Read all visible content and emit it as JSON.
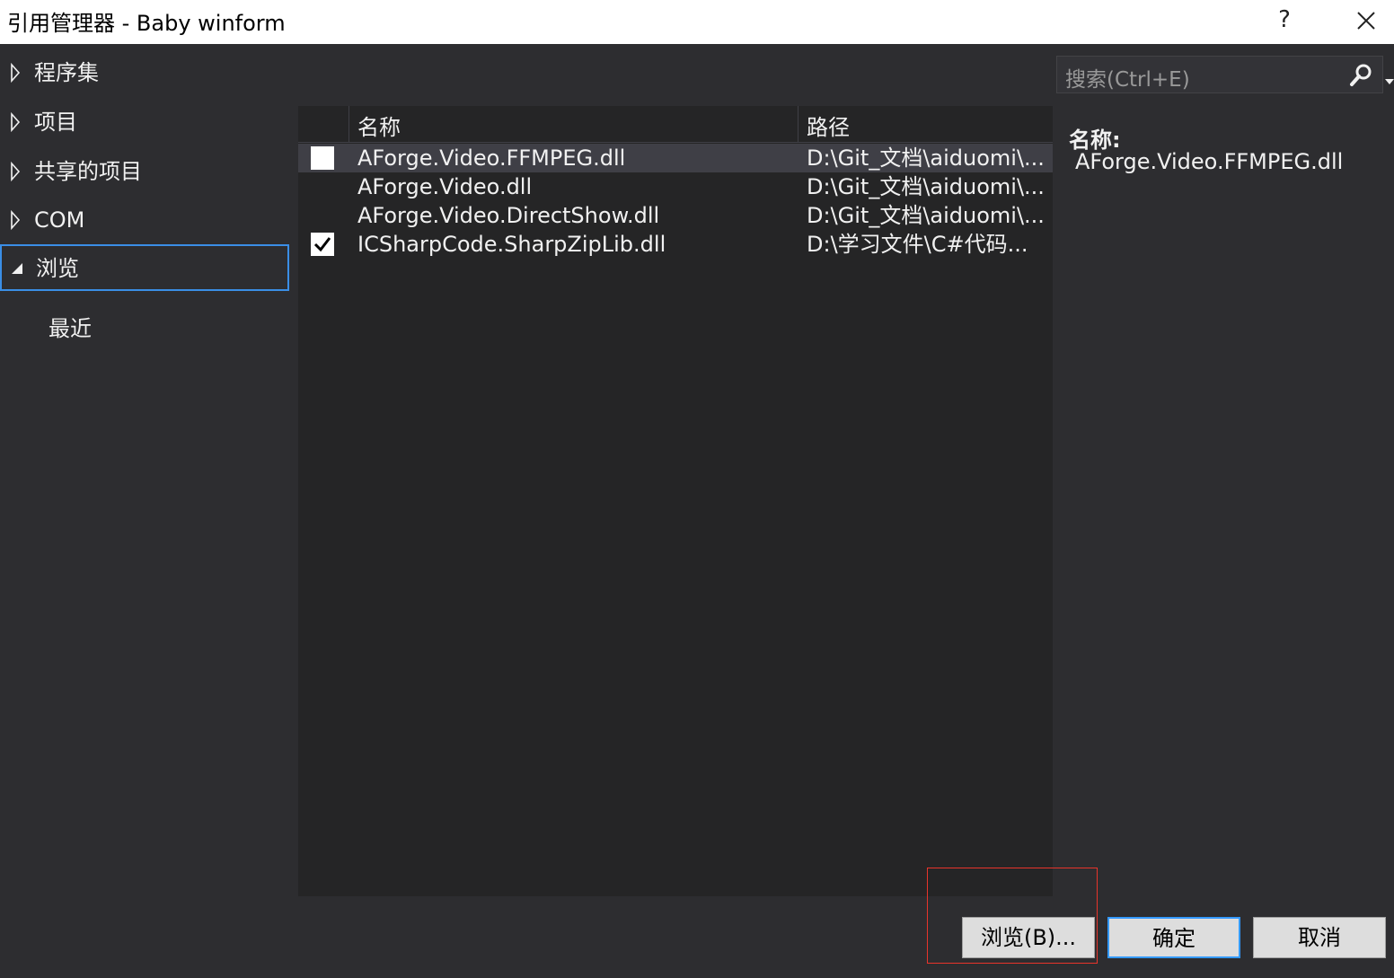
{
  "window": {
    "title": "引用管理器 - Baby winform",
    "help_label": "?"
  },
  "sidebar": {
    "items": [
      {
        "label": "程序集",
        "expanded": false
      },
      {
        "label": "项目",
        "expanded": false
      },
      {
        "label": "共享的项目",
        "expanded": false
      },
      {
        "label": "COM",
        "expanded": false
      },
      {
        "label": "浏览",
        "expanded": true,
        "selected": true
      }
    ],
    "sub_items": [
      {
        "label": "最近"
      }
    ]
  },
  "list": {
    "columns": [
      "名称",
      "路径"
    ],
    "rows": [
      {
        "name": "AForge.Video.FFMPEG.dll",
        "path": "D:\\Git_文档\\aiduomi\\...",
        "checked": false,
        "selected": true
      },
      {
        "name": "AForge.Video.dll",
        "path": "D:\\Git_文档\\aiduomi\\...",
        "checked": false,
        "selected": false
      },
      {
        "name": "AForge.Video.DirectShow.dll",
        "path": "D:\\Git_文档\\aiduomi\\...",
        "checked": false,
        "selected": false
      },
      {
        "name": "ICSharpCode.SharpZipLib.dll",
        "path": "D:\\学习文件\\C#代码...",
        "checked": true,
        "selected": false
      }
    ]
  },
  "search": {
    "placeholder": "搜索(Ctrl+E)"
  },
  "details": {
    "label": "名称:",
    "value": "AForge.Video.FFMPEG.dll"
  },
  "buttons": {
    "browse": "浏览(B)...",
    "ok": "确定",
    "cancel": "取消"
  },
  "colors": {
    "background": "#2d2d30",
    "list_background": "#252526",
    "selection_border": "#3a8ee6",
    "highlight_annotation": "#e8342b"
  }
}
